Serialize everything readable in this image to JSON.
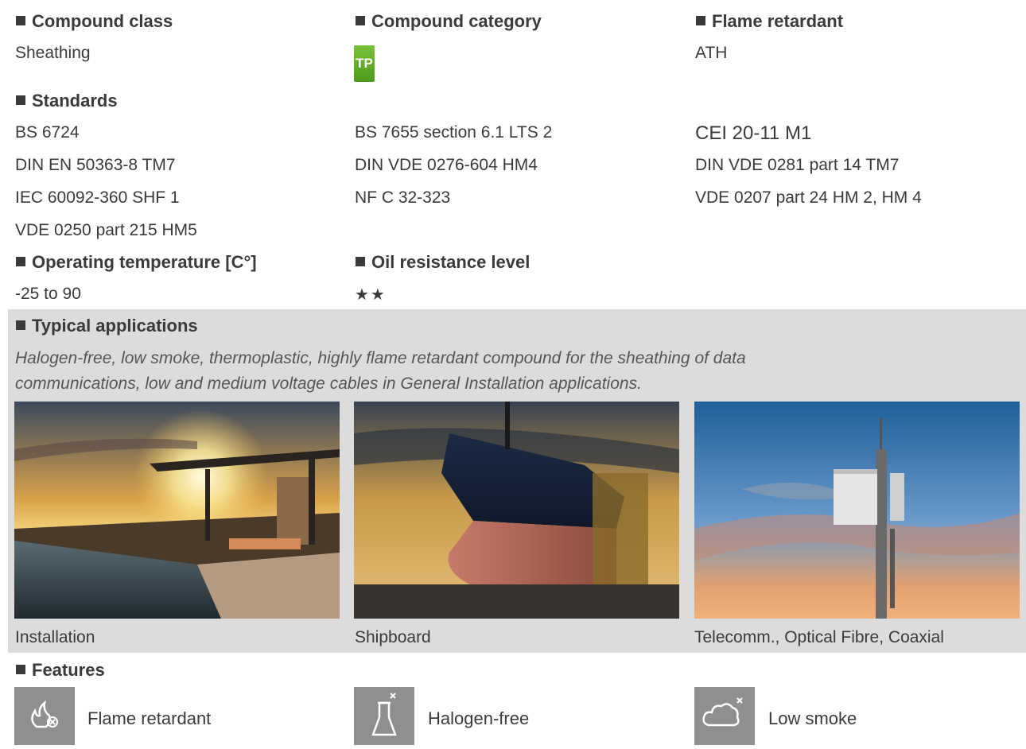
{
  "compound_class": {
    "label": "Compound class",
    "value": "Sheathing"
  },
  "compound_category": {
    "label": "Compound category",
    "badge": "TP",
    "badge_color": "#5fae24"
  },
  "flame_retardant": {
    "label": "Flame retardant",
    "value": "ATH"
  },
  "standards": {
    "label": "Standards",
    "col1": [
      "BS 6724",
      "DIN EN 50363-8 TM7",
      "IEC 60092-360 SHF 1",
      "VDE 0250 part 215 HM5"
    ],
    "col2": [
      "BS 7655 section 6.1 LTS 2",
      "DIN VDE 0276-604 HM4",
      "NF C 32-323"
    ],
    "col3": [
      "CEI 20-11 M1",
      "DIN VDE 0281 part 14 TM7",
      "VDE 0207 part 24 HM 2, HM 4"
    ]
  },
  "operating_temperature": {
    "label": "Operating temperature [C°]",
    "value": "-25 to 90"
  },
  "oil_resistance": {
    "label": "Oil resistance level",
    "stars": "★★"
  },
  "typical_applications": {
    "label": "Typical applications",
    "text_line1": "Halogen-free, low smoke, thermoplastic, highly flame retardant compound for the sheathing of data",
    "text_line2": "communications, low and medium voltage cables in General Installation applications.",
    "images": [
      {
        "caption": "Installation",
        "icon": "villa-pool-sunset-photo"
      },
      {
        "caption": "Shipboard",
        "icon": "ship-drydock-photo"
      },
      {
        "caption": "Telecomm., Optical Fibre, Coaxial",
        "icon": "telecom-tower-photo"
      }
    ]
  },
  "features": {
    "label": "Features",
    "items": [
      {
        "label": "Flame retardant",
        "icon": "flame-x-icon"
      },
      {
        "label": "Halogen-free",
        "icon": "flask-x-icon"
      },
      {
        "label": "Low smoke",
        "icon": "cloud-x-icon"
      }
    ]
  },
  "colors": {
    "band": "#dcdcdc",
    "icon_bg": "#8f8f8f",
    "text": "#3a3a3a"
  }
}
